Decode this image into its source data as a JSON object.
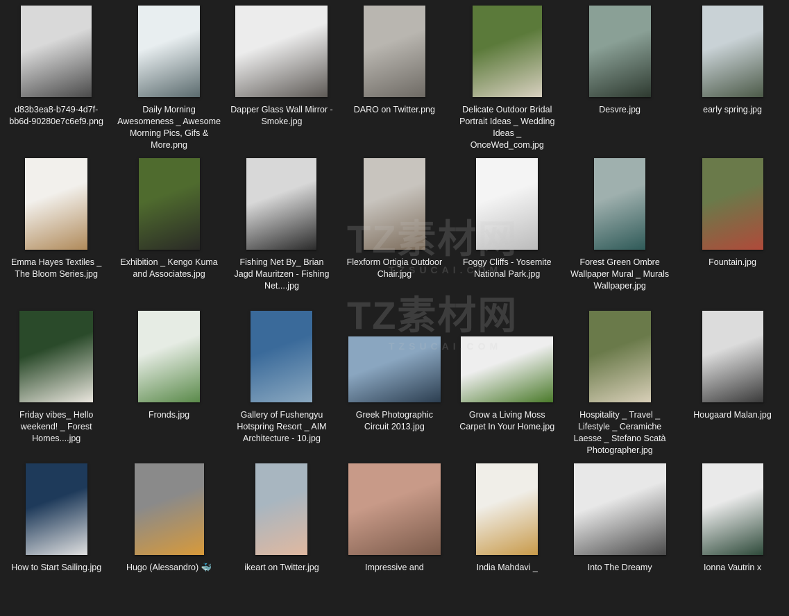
{
  "watermark": "TZ素材网",
  "watermark_sub": "TZSUCAI.COM",
  "files": [
    {
      "name": "d83b3ea8-b749-4d7f-bb6d-90280e7c6ef9.png",
      "colors": [
        "#d9d9d9",
        "#4a4a4a"
      ]
    },
    {
      "name": "Daily Morning Awesomeness _ Awesome Morning Pics, Gifs & More.png",
      "colors": [
        "#e8eef0",
        "#5b6b6e"
      ]
    },
    {
      "name": "Dapper Glass Wall Mirror - Smoke.jpg",
      "colors": [
        "#ececec",
        "#5e5a56"
      ]
    },
    {
      "name": "DARO on Twitter.png",
      "colors": [
        "#b9b6b0",
        "#6e6a64"
      ]
    },
    {
      "name": "Delicate Outdoor Bridal Portrait Ideas _ Wedding Ideas _ OnceWed_com.jpg",
      "colors": [
        "#5b7a3a",
        "#d8d0c0"
      ]
    },
    {
      "name": "Desvre.jpg",
      "colors": [
        "#8aa096",
        "#2e3a30"
      ]
    },
    {
      "name": "early spring.jpg",
      "colors": [
        "#c9d2d6",
        "#4c5a48"
      ]
    },
    {
      "name": "Emma Hayes Textiles _ The Bloom Series.jpg",
      "colors": [
        "#f2f0ec",
        "#b08a5a"
      ]
    },
    {
      "name": "Exhibition _ Kengo Kuma and Associates.jpg",
      "colors": [
        "#4f6b2e",
        "#2a2a26"
      ]
    },
    {
      "name": "Fishing Net By_ Brian Jagd Mauritzen - Fishing Net....jpg",
      "colors": [
        "#d8d8d8",
        "#2b2b2b"
      ]
    },
    {
      "name": "Flexform Ortigia Outdoor Chair.jpg",
      "colors": [
        "#c8c4be",
        "#7b6b5a"
      ]
    },
    {
      "name": "Foggy Cliffs - Yosemite National Park.jpg",
      "colors": [
        "#f4f4f4",
        "#bbbbbb"
      ]
    },
    {
      "name": "Forest Green Ombre Wallpaper Mural _ Murals Wallpaper.jpg",
      "colors": [
        "#9fb0ae",
        "#2f5a58"
      ]
    },
    {
      "name": "Fountain.jpg",
      "colors": [
        "#6a7a4a",
        "#b04a3a"
      ]
    },
    {
      "name": "Friday vibes_ Hello weekend! _ Forest Homes....jpg",
      "colors": [
        "#2a4a2a",
        "#eae6de"
      ]
    },
    {
      "name": "Fronds.jpg",
      "colors": [
        "#e6ece4",
        "#5a8a4a"
      ]
    },
    {
      "name": "Gallery of Fushengyu Hotspring Resort _ AIM Architecture  - 10.jpg",
      "colors": [
        "#3a6a9a",
        "#8aa8c0"
      ]
    },
    {
      "name": "Greek Photographic Circuit 2013.jpg",
      "colors": [
        "#8aa6c0",
        "#2c3e50"
      ]
    },
    {
      "name": "Grow a Living Moss Carpet In Your Home.jpg",
      "colors": [
        "#eeeeee",
        "#4a7a2a"
      ]
    },
    {
      "name": "Hospitality _ Travel _ Lifestyle _ Ceramiche Laesse _ Stefano Scatà Photographer.jpg",
      "colors": [
        "#6a7a4a",
        "#d8cfb8"
      ]
    },
    {
      "name": "Hougaard Malan.jpg",
      "colors": [
        "#dcdcdc",
        "#3a3a3a"
      ]
    },
    {
      "name": "How to Start Sailing.jpg",
      "colors": [
        "#1e3a5a",
        "#e0e0e0"
      ]
    },
    {
      "name": "Hugo (Alessandro) 🐳",
      "colors": [
        "#8a8a8a",
        "#d89a3a"
      ]
    },
    {
      "name": "ikeart on Twitter.jpg",
      "colors": [
        "#a8b6c0",
        "#e0b8a0"
      ]
    },
    {
      "name": "Impressive and",
      "colors": [
        "#c89a88",
        "#7a5a4a"
      ]
    },
    {
      "name": "India Mahdavi _",
      "colors": [
        "#f0eee8",
        "#c89a4a"
      ]
    },
    {
      "name": "Into The Dreamy",
      "colors": [
        "#e8e8e8",
        "#4a4a4a"
      ]
    },
    {
      "name": "Ionna Vautrin x",
      "colors": [
        "#eaeaea",
        "#2e4a3a"
      ]
    }
  ]
}
